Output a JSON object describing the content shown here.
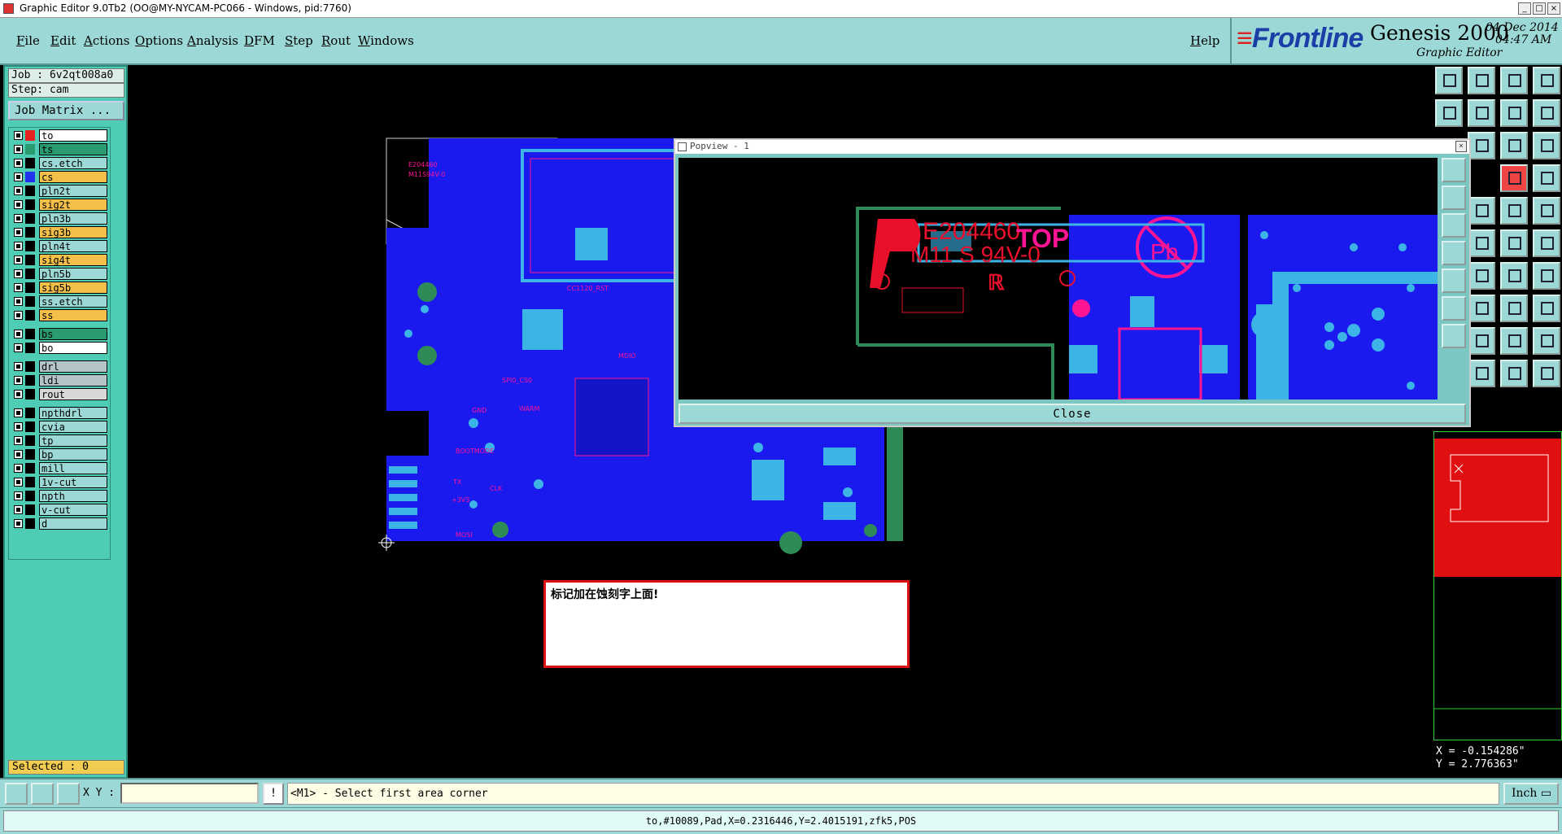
{
  "window": {
    "title": "Graphic Editor 9.0Tb2 (OO@MY-NYCAM-PC066 - Windows, pid:7760)"
  },
  "menu": [
    "File",
    "Edit",
    "Actions",
    "Options",
    "Analysis",
    "DFM",
    "Step",
    "Rout",
    "Windows"
  ],
  "help": "Help",
  "brand": {
    "frontline": "Frontline",
    "product": "Genesis 2000",
    "subtitle": "Graphic Editor",
    "date": "04 Dec 2014",
    "time": "04:47 AM"
  },
  "job": {
    "job_label": "Job : 6v2qt008a0",
    "step_label": "Step: cam",
    "matrix_button": "Job Matrix ..."
  },
  "layers": [
    {
      "name": "to",
      "bg": "#ffffff",
      "swatch": "#e52222"
    },
    {
      "name": "ts",
      "bg": "#2a9a70",
      "swatch": "#2a9a70"
    },
    {
      "name": "cs.etch",
      "bg": "#9cd9d6",
      "swatch": "#000000"
    },
    {
      "name": "cs",
      "bg": "#f4c04a",
      "swatch": "#2233ee"
    },
    {
      "name": "pln2t",
      "bg": "#9cd9d6",
      "swatch": "#000000"
    },
    {
      "name": "sig2t",
      "bg": "#f4c04a",
      "swatch": "#000000"
    },
    {
      "name": "pln3b",
      "bg": "#9cd9d6",
      "swatch": "#000000"
    },
    {
      "name": "sig3b",
      "bg": "#f4c04a",
      "swatch": "#000000"
    },
    {
      "name": "pln4t",
      "bg": "#9cd9d6",
      "swatch": "#000000"
    },
    {
      "name": "sig4t",
      "bg": "#f4c04a",
      "swatch": "#000000"
    },
    {
      "name": "pln5b",
      "bg": "#9cd9d6",
      "swatch": "#000000"
    },
    {
      "name": "sig5b",
      "bg": "#f4c04a",
      "swatch": "#000000"
    },
    {
      "name": "ss.etch",
      "bg": "#9cd9d6",
      "swatch": "#000000"
    },
    {
      "name": "ss",
      "bg": "#f4c04a",
      "swatch": "#000000"
    },
    {
      "name": "bs",
      "bg": "#2a9a70",
      "swatch": "#000000"
    },
    {
      "name": "bo",
      "bg": "#ffffff",
      "swatch": "#000000"
    },
    {
      "name": "drl",
      "bg": "#b3c5c9",
      "swatch": "#000000"
    },
    {
      "name": "ldi",
      "bg": "#b3c5c9",
      "swatch": "#000000"
    },
    {
      "name": "rout",
      "bg": "#d8d8d8",
      "swatch": "#000000"
    },
    {
      "name": "npthdrl",
      "bg": "#9cd9d6",
      "swatch": "#000000"
    },
    {
      "name": "cvia",
      "bg": "#9cd9d6",
      "swatch": "#000000"
    },
    {
      "name": "tp",
      "bg": "#9cd9d6",
      "swatch": "#000000"
    },
    {
      "name": "bp",
      "bg": "#9cd9d6",
      "swatch": "#000000"
    },
    {
      "name": "mill",
      "bg": "#9cd9d6",
      "swatch": "#000000"
    },
    {
      "name": "1v-cut",
      "bg": "#9cd9d6",
      "swatch": "#000000"
    },
    {
      "name": "npth",
      "bg": "#9cd9d6",
      "swatch": "#000000"
    },
    {
      "name": "v-cut",
      "bg": "#9cd9d6",
      "swatch": "#000000"
    },
    {
      "name": "d",
      "bg": "#9cd9d6",
      "swatch": "#000000"
    }
  ],
  "selected": "Selected : 0",
  "board_labels": [
    "E204460",
    "M11S94V-0",
    "BOOTMODE",
    "GND",
    "TX",
    "+3V3",
    "CLK",
    "MOSI",
    "SPI0_CS0",
    "WARM",
    "MDIO",
    "CC1120_RST"
  ],
  "popview": {
    "title": "Popview - 1",
    "label1": "E204460",
    "label2": "M11 S 94V-0",
    "label3": "TOP",
    "label4": "Pb",
    "close": "Close"
  },
  "message": "标记加在蚀刻字上面!",
  "coords": {
    "x": "X = -0.154286\"",
    "y": "Y = 2.776363\""
  },
  "command": {
    "xy_label": "X Y :",
    "xy_value": "",
    "alert": "!",
    "prompt": "<M1> - Select first area corner",
    "unit": "Inch"
  },
  "status": "to,#10089,Pad,X=0.2316446,Y=2.4015191,zfk5,POS",
  "colors": {
    "panel": "#9cd9d6",
    "board_blue": "#1a1aee",
    "cyan": "#3cb4e6",
    "pink": "#ff1493",
    "green": "#2e8b57"
  }
}
